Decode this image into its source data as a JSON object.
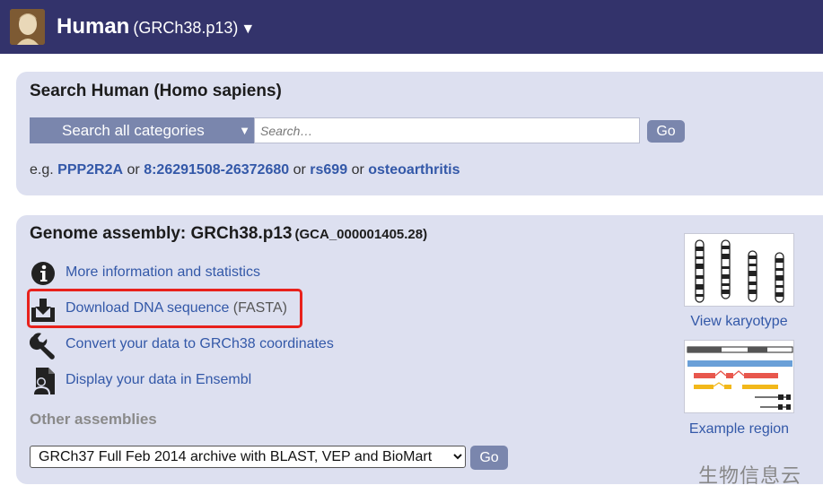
{
  "header": {
    "species_name": "Human",
    "assembly": "(GRCh38.p13)",
    "caret": "▼"
  },
  "search": {
    "title": "Search Human (Homo sapiens)",
    "category_label": "Search all categories",
    "category_arrow": "▼",
    "placeholder": "Search…",
    "go_label": "Go",
    "examples_prefix": "e.g.",
    "or_text": "or",
    "examples": [
      "PPP2R2A",
      "8:26291508-26372680",
      "rs699",
      "osteoarthritis"
    ]
  },
  "genome": {
    "title": "Genome assembly: GRCh38.p13",
    "accession": "(GCA_000001405.28)",
    "links": [
      {
        "label": "More information and statistics",
        "suffix": "",
        "icon": "info-icon"
      },
      {
        "label": "Download DNA sequence",
        "suffix": " (FASTA)",
        "icon": "download-icon"
      },
      {
        "label": "Convert your data to GRCh38 coordinates",
        "suffix": "",
        "icon": "wrench-icon"
      },
      {
        "label": "Display your data in Ensembl",
        "suffix": "",
        "icon": "user-data-icon"
      }
    ],
    "other_assemblies_title": "Other assemblies",
    "other_assemblies_selected": "GRCh37 Full Feb 2014 archive with BLAST, VEP and BioMart",
    "go_label": "Go",
    "karyotype_label": "View karyotype",
    "region_label": "Example region"
  },
  "watermark": "生物信息云",
  "colors": {
    "header_bg": "#33336b",
    "panel_bg": "#dde0f0",
    "link": "#3358a8",
    "button": "#7a86ad",
    "highlight": "#e8211c"
  }
}
